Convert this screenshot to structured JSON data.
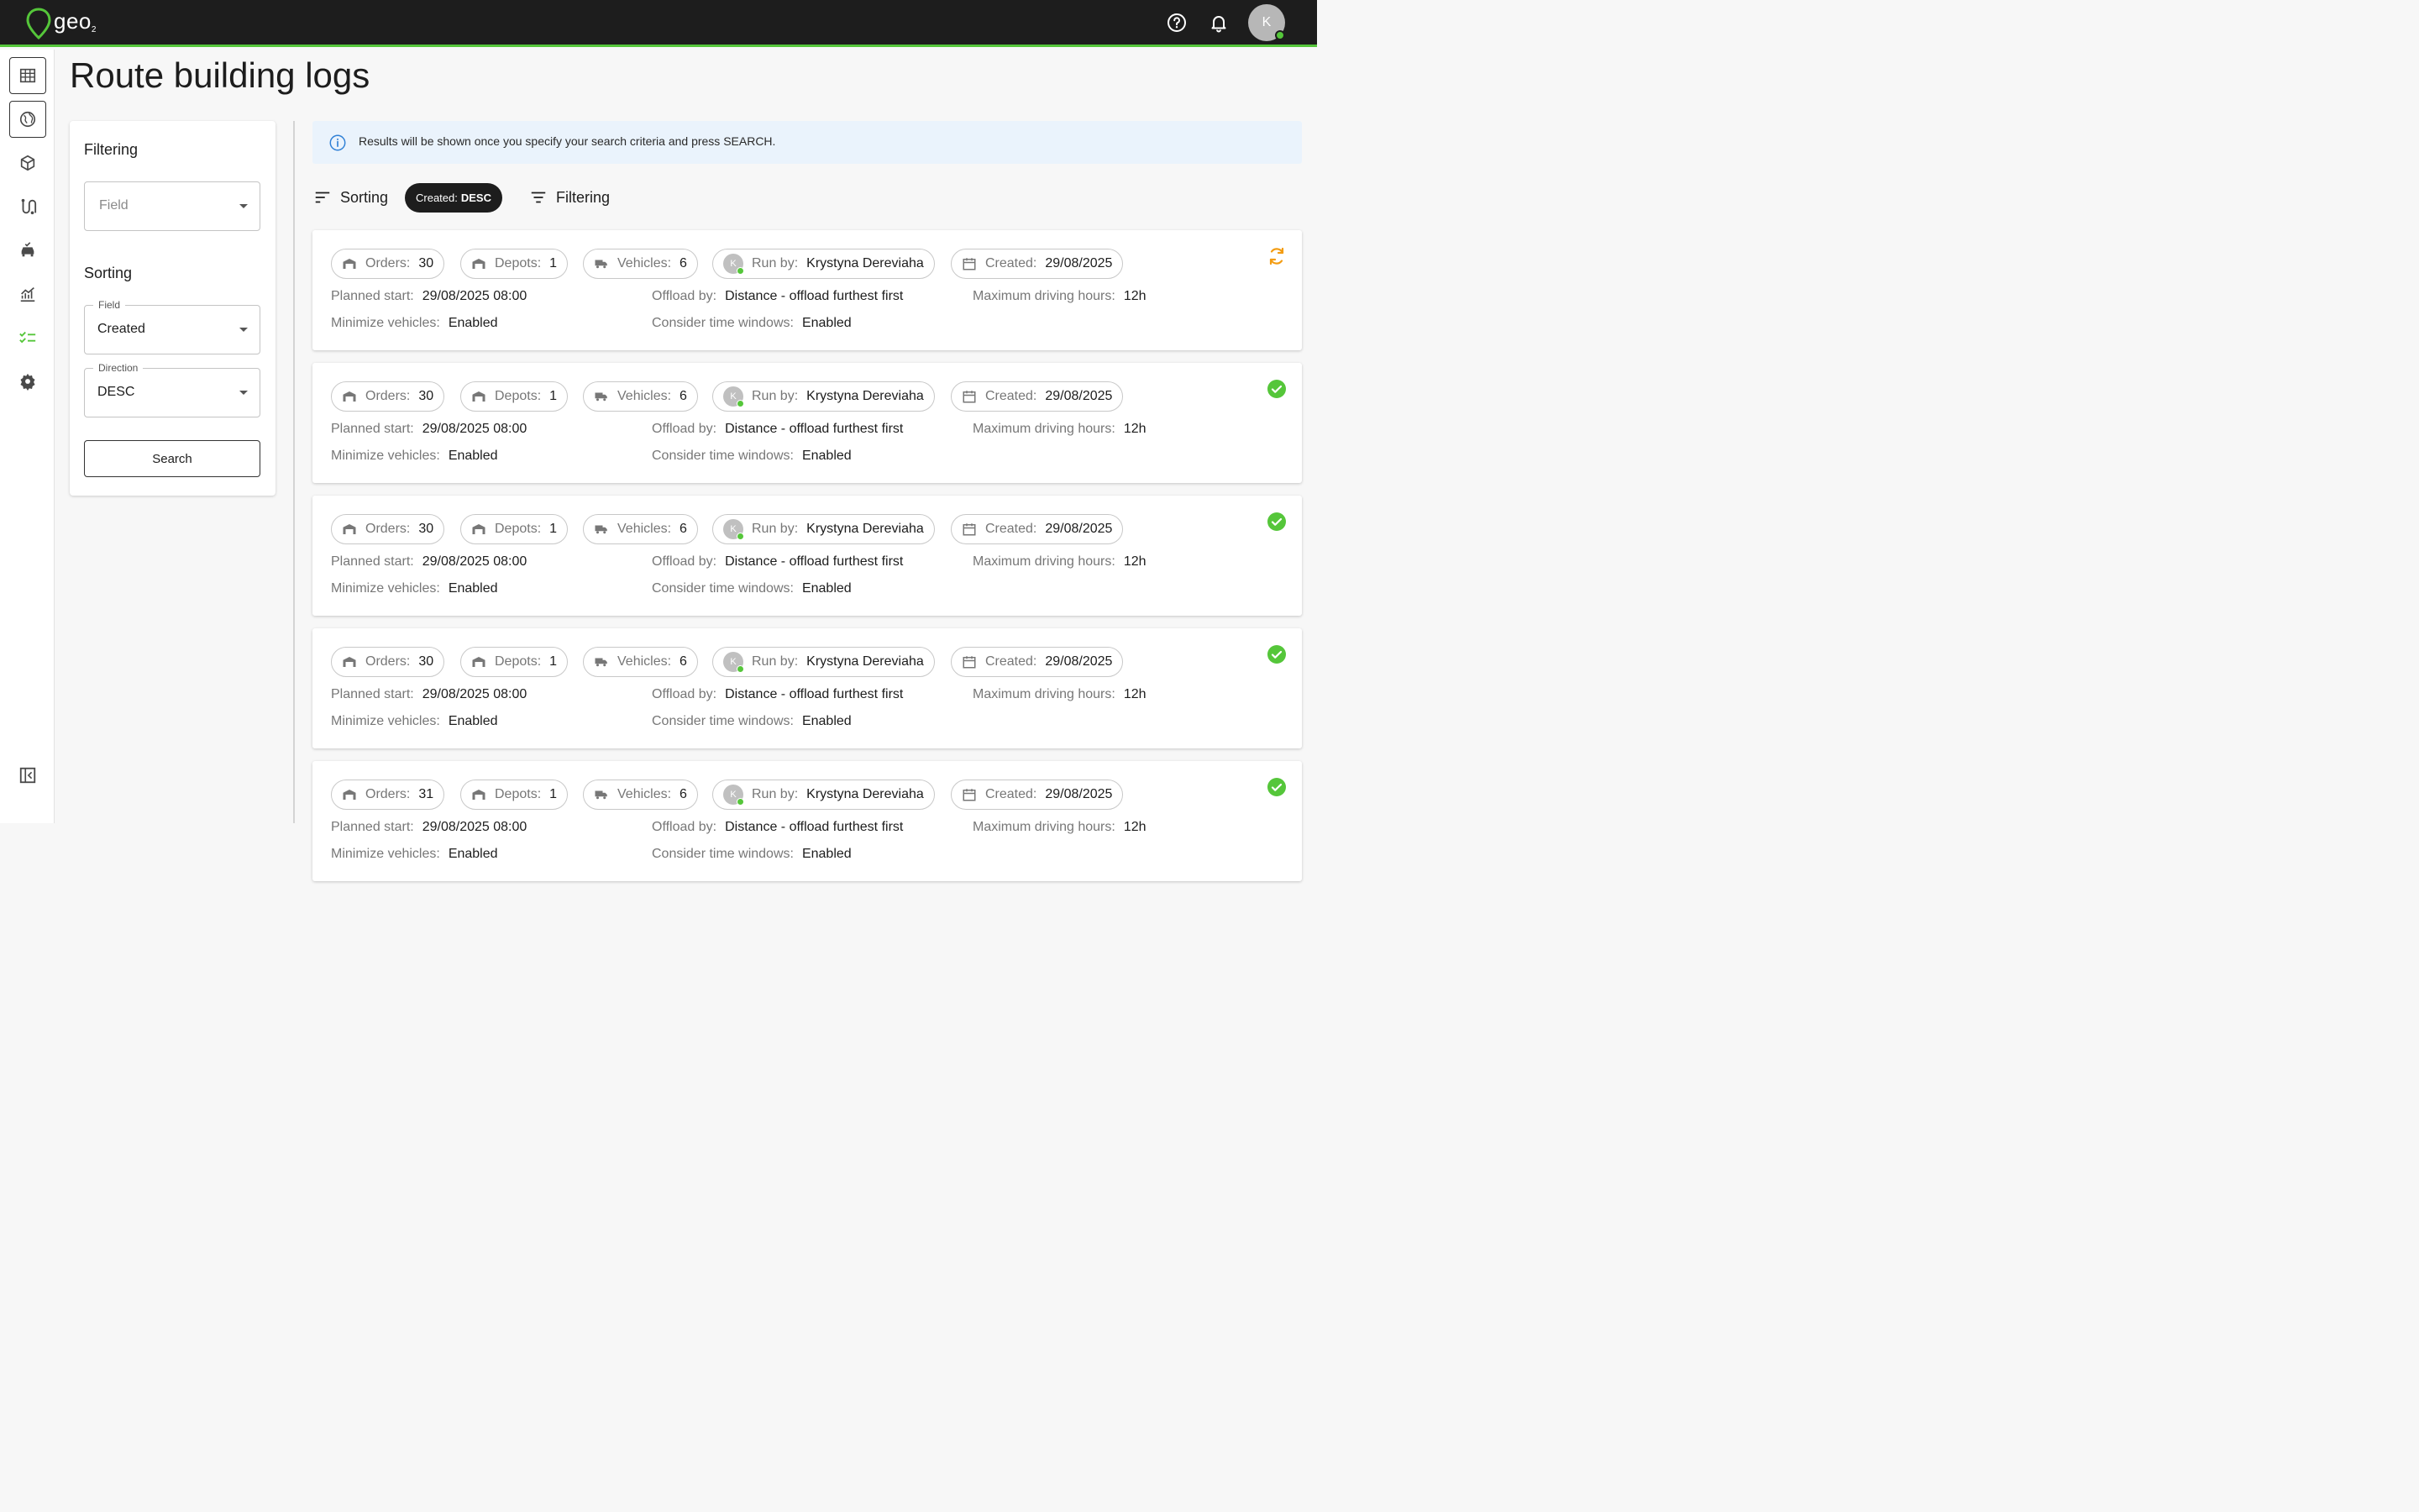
{
  "app": {
    "logo_text": "geo",
    "logo_sub": "2",
    "user_initial": "K"
  },
  "page": {
    "title": "Route building logs"
  },
  "filter_panel": {
    "filtering_heading": "Filtering",
    "field_placeholder": "Field",
    "sorting_heading": "Sorting",
    "sort_field_label": "Field",
    "sort_field_value": "Created",
    "direction_label": "Direction",
    "direction_value": "DESC",
    "search_label": "Search"
  },
  "banner": {
    "text": "Results will be shown once you specify your search criteria and press SEARCH."
  },
  "toolbar": {
    "sorting_label": "Sorting",
    "chip_prefix": "Created:",
    "chip_value": "DESC",
    "filtering_label": "Filtering"
  },
  "labels": {
    "orders": "Orders:",
    "depots": "Depots:",
    "vehicles": "Vehicles:",
    "run_by": "Run by:",
    "created": "Created:",
    "planned_start": "Planned start:",
    "offload_by": "Offload by:",
    "max_hours": "Maximum driving hours:",
    "minimize_vehicles": "Minimize vehicles:",
    "time_windows": "Consider time windows:"
  },
  "results": [
    {
      "orders": "30",
      "depots": "1",
      "vehicles": "6",
      "run_by_initial": "K",
      "run_by": "Krystyna Dereviaha",
      "created": "29/08/2025",
      "planned_start": "29/08/2025 08:00",
      "offload_by": "Distance - offload furthest first",
      "max_hours": "12h",
      "minimize_vehicles": "Enabled",
      "time_windows": "Enabled",
      "status": "in-progress",
      "status_icon": "refresh-icon"
    },
    {
      "orders": "30",
      "depots": "1",
      "vehicles": "6",
      "run_by_initial": "K",
      "run_by": "Krystyna Dereviaha",
      "created": "29/08/2025",
      "planned_start": "29/08/2025 08:00",
      "offload_by": "Distance - offload furthest first",
      "max_hours": "12h",
      "minimize_vehicles": "Enabled",
      "time_windows": "Enabled",
      "status": "completed",
      "status_icon": "check-circle-icon"
    },
    {
      "orders": "30",
      "depots": "1",
      "vehicles": "6",
      "run_by_initial": "K",
      "run_by": "Krystyna Dereviaha",
      "created": "29/08/2025",
      "planned_start": "29/08/2025 08:00",
      "offload_by": "Distance - offload furthest first",
      "max_hours": "12h",
      "minimize_vehicles": "Enabled",
      "time_windows": "Enabled",
      "status": "completed",
      "status_icon": "check-circle-icon"
    },
    {
      "orders": "30",
      "depots": "1",
      "vehicles": "6",
      "run_by_initial": "K",
      "run_by": "Krystyna Dereviaha",
      "created": "29/08/2025",
      "planned_start": "29/08/2025 08:00",
      "offload_by": "Distance - offload furthest first",
      "max_hours": "12h",
      "minimize_vehicles": "Enabled",
      "time_windows": "Enabled",
      "status": "completed",
      "status_icon": "check-circle-icon"
    },
    {
      "orders": "31",
      "depots": "1",
      "vehicles": "6",
      "run_by_initial": "K",
      "run_by": "Krystyna Dereviaha",
      "created": "29/08/2025",
      "planned_start": "29/08/2025 08:00",
      "offload_by": "Distance - offload furthest first",
      "max_hours": "12h",
      "minimize_vehicles": "Enabled",
      "time_windows": "Enabled",
      "status": "completed",
      "status_icon": "check-circle-icon"
    }
  ],
  "colors": {
    "accent": "#55c63a",
    "topbar": "#1d1d1d",
    "in_progress": "#f39c12",
    "info": "#2f80d6"
  }
}
